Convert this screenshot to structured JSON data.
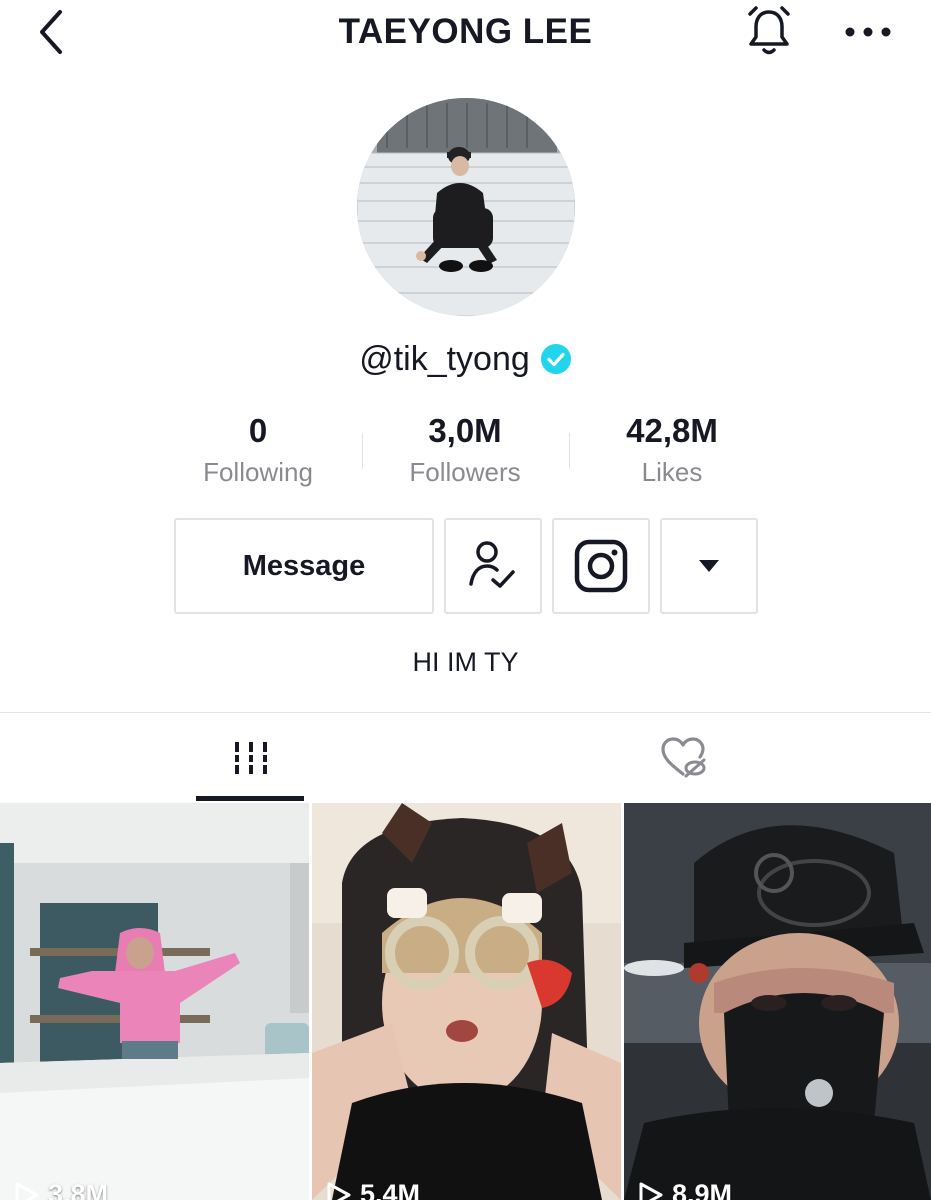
{
  "header": {
    "title": "TAEYONG LEE",
    "back_icon": "chevron-left-icon",
    "bell_icon": "bell-icon",
    "more_icon": "more-horizontal-icon"
  },
  "profile": {
    "handle": "@tik_tyong",
    "verified": true,
    "bio": "HI IM TY"
  },
  "stats": [
    {
      "value": "0",
      "label": "Following"
    },
    {
      "value": "3,0M",
      "label": "Followers"
    },
    {
      "value": "42,8M",
      "label": "Likes"
    }
  ],
  "actions": {
    "message_label": "Message",
    "follow_icon": "user-check-icon",
    "instagram_icon": "instagram-icon",
    "dropdown_icon": "caret-down-icon"
  },
  "tabs": [
    {
      "name": "videos",
      "icon": "grid-lines-icon",
      "active": true
    },
    {
      "name": "liked",
      "icon": "heart-hidden-icon",
      "active": false
    }
  ],
  "videos": [
    {
      "views": "3.8M"
    },
    {
      "views": "5.4M"
    },
    {
      "views": "8.9M"
    }
  ],
  "colors": {
    "text": "#161823",
    "muted": "#8a8b91",
    "border": "#e3e3e4",
    "verified": "#20d5ec"
  }
}
